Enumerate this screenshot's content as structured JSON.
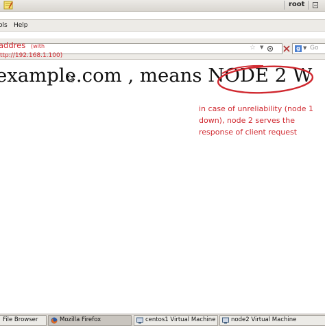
{
  "panel": {
    "user": "root"
  },
  "menubar": {
    "tools": "ols",
    "help": "Help"
  },
  "navbar": {
    "url_value": "",
    "search_placeholder": "Go"
  },
  "annotation_top": {
    "addres": "addres",
    "with": "(with",
    "ip": "ttp://192.168.1.100)"
  },
  "content": {
    "headline_before": "example.com , means ",
    "headline_node": "NODE 2",
    "headline_after": " W"
  },
  "annotation_note": {
    "lines": [
      "in case of unreliability (node 1",
      "down), node 2 serves the",
      "response of client request"
    ]
  },
  "taskbar": {
    "items": [
      {
        "label": "File Browser"
      },
      {
        "label": "Mozilla Firefox"
      },
      {
        "label": "centos1 Virtual Machine"
      },
      {
        "label": "node2 Virtual Machine"
      }
    ]
  },
  "colors": {
    "annotation": "#d0282f",
    "panel": "#d9d6d0"
  }
}
